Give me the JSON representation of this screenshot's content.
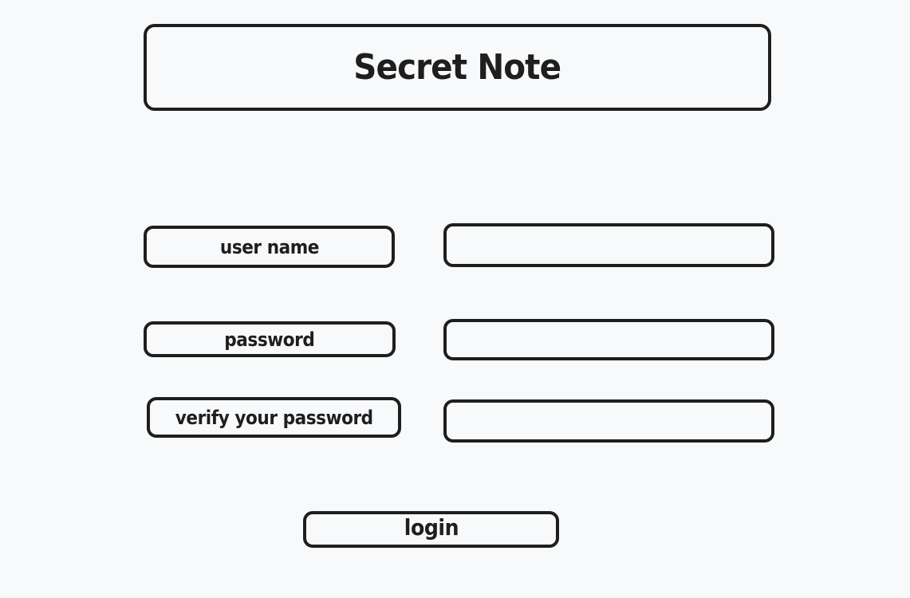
{
  "app": {
    "title": "Secret Note"
  },
  "form": {
    "username": {
      "label": "user name",
      "value": ""
    },
    "password": {
      "label": "password",
      "value": ""
    },
    "verify_password": {
      "label": "verify your password",
      "value": ""
    },
    "login_label": "login"
  },
  "colors": {
    "background": "#f8f9fa",
    "stroke": "#1e1e1e"
  }
}
